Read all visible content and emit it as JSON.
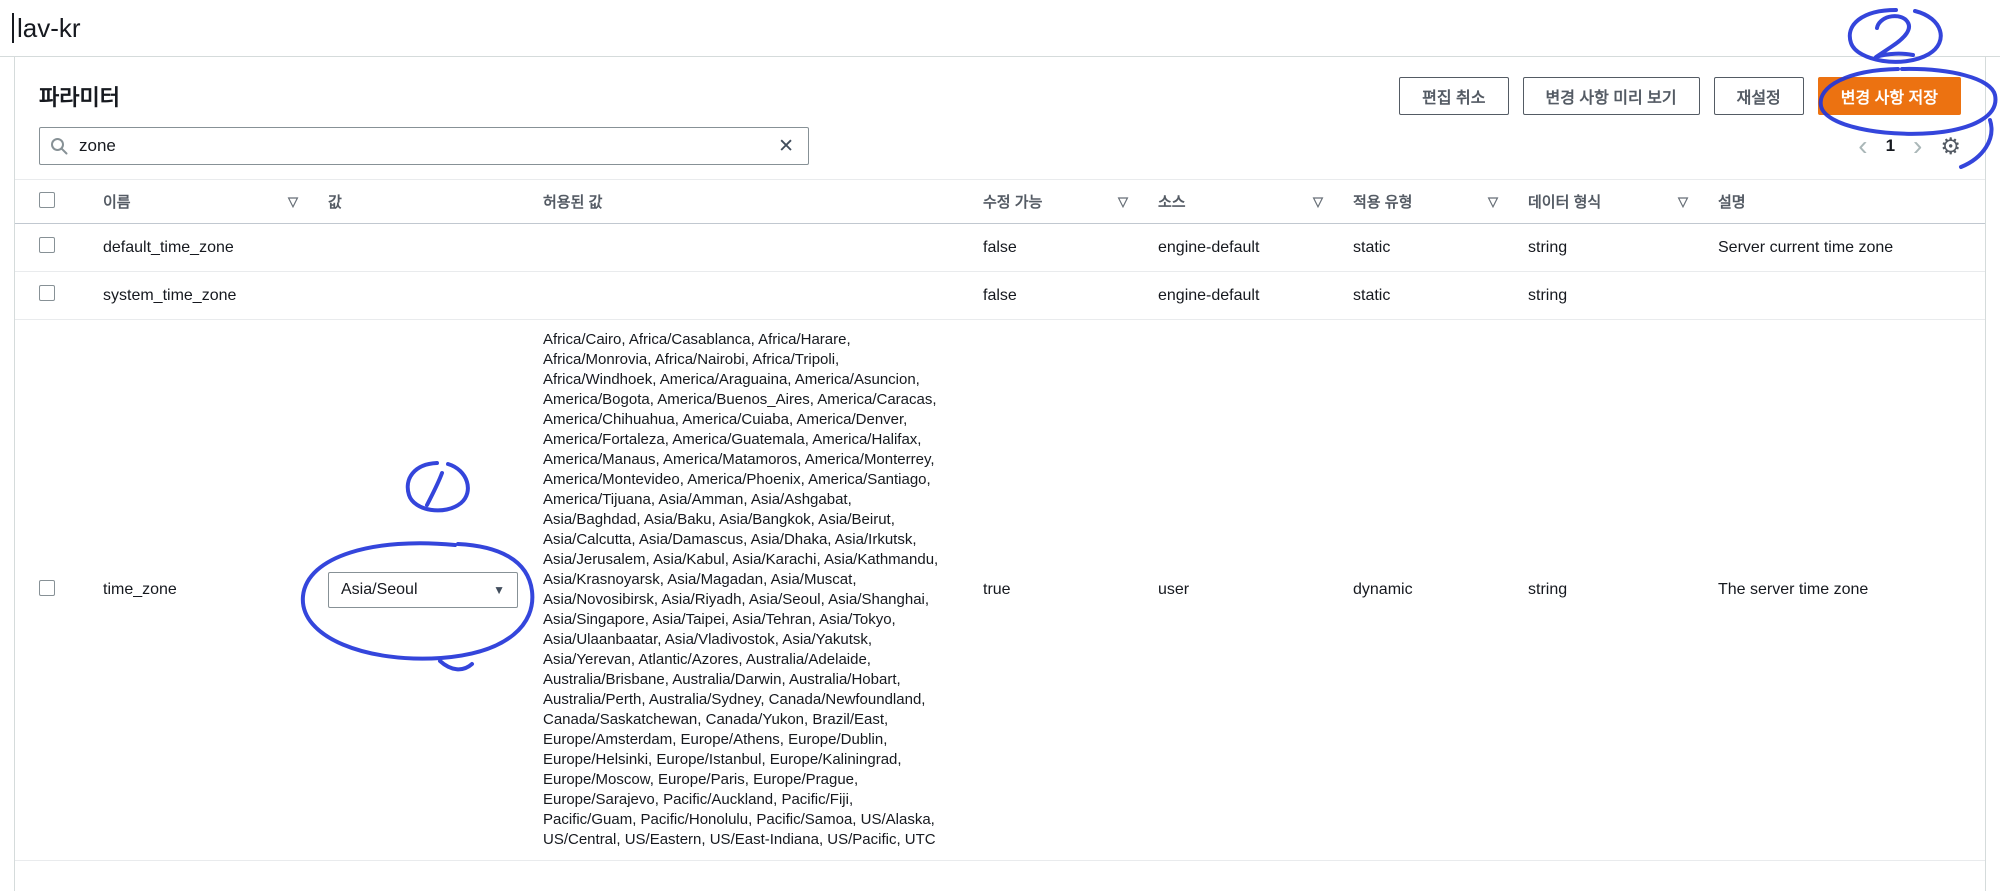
{
  "page": {
    "title": "lav-kr"
  },
  "panel": {
    "heading": "파라미터",
    "buttons": {
      "cancel": "편집 취소",
      "preview": "변경 사항 미리 보기",
      "reset": "재설정",
      "save": "변경 사항 저장"
    },
    "search": {
      "value": "zone"
    },
    "pagination": {
      "current_page": "1"
    }
  },
  "table": {
    "columns": [
      {
        "label": "이름",
        "filterable": true
      },
      {
        "label": "값",
        "filterable": false
      },
      {
        "label": "허용된 값",
        "filterable": false
      },
      {
        "label": "수정 가능",
        "filterable": true
      },
      {
        "label": "소스",
        "filterable": true
      },
      {
        "label": "적용 유형",
        "filterable": true
      },
      {
        "label": "데이터 형식",
        "filterable": true
      },
      {
        "label": "설명",
        "filterable": false
      }
    ],
    "rows": [
      {
        "name": "default_time_zone",
        "value": "",
        "allowed_values": "",
        "modifiable": "false",
        "source": "engine-default",
        "apply_type": "static",
        "data_type": "string",
        "description": "Server current time zone"
      },
      {
        "name": "system_time_zone",
        "value": "",
        "allowed_values": "",
        "modifiable": "false",
        "source": "engine-default",
        "apply_type": "static",
        "data_type": "string",
        "description": ""
      },
      {
        "name": "time_zone",
        "value": "Asia/Seoul",
        "allowed_values": "Africa/Cairo, Africa/Casablanca, Africa/Harare, Africa/Monrovia, Africa/Nairobi, Africa/Tripoli, Africa/Windhoek, America/Araguaina, America/Asuncion, America/Bogota, America/Buenos_Aires, America/Caracas, America/Chihuahua, America/Cuiaba, America/Denver, America/Fortaleza, America/Guatemala, America/Halifax, America/Manaus, America/Matamoros, America/Monterrey, America/Montevideo, America/Phoenix, America/Santiago, America/Tijuana, Asia/Amman, Asia/Ashgabat, Asia/Baghdad, Asia/Baku, Asia/Bangkok, Asia/Beirut, Asia/Calcutta, Asia/Damascus, Asia/Dhaka, Asia/Irkutsk, Asia/Jerusalem, Asia/Kabul, Asia/Karachi, Asia/Kathmandu, Asia/Krasnoyarsk, Asia/Magadan, Asia/Muscat, Asia/Novosibirsk, Asia/Riyadh, Asia/Seoul, Asia/Shanghai, Asia/Singapore, Asia/Taipei, Asia/Tehran, Asia/Tokyo, Asia/Ulaanbaatar, Asia/Vladivostok, Asia/Yakutsk, Asia/Yerevan, Atlantic/Azores, Australia/Adelaide, Australia/Brisbane, Australia/Darwin, Australia/Hobart, Australia/Perth, Australia/Sydney, Canada/Newfoundland, Canada/Saskatchewan, Canada/Yukon, Brazil/East, Europe/Amsterdam, Europe/Athens, Europe/Dublin, Europe/Helsinki, Europe/Istanbul, Europe/Kaliningrad, Europe/Moscow, Europe/Paris, Europe/Prague, Europe/Sarajevo, Pacific/Auckland, Pacific/Fiji, Pacific/Guam, Pacific/Honolulu, Pacific/Samoa, US/Alaska, US/Central, US/Eastern, US/East-Indiana, US/Pacific, UTC",
        "modifiable": "true",
        "source": "user",
        "apply_type": "dynamic",
        "data_type": "string",
        "description": "The server time zone"
      }
    ]
  },
  "icons": {
    "clear": "✕",
    "filter": "▽",
    "dropdown_caret": "▼",
    "chevron_left": "‹",
    "chevron_right": "›",
    "settings": "⚙"
  },
  "annotations": {
    "ink_color": "#2336d9",
    "steps": [
      "1",
      "2"
    ]
  },
  "colors": {
    "primary_button": "#ec7211",
    "primary_button_text": "#ffffff",
    "header_text": "#545b64",
    "border": "#d5dbdb"
  }
}
